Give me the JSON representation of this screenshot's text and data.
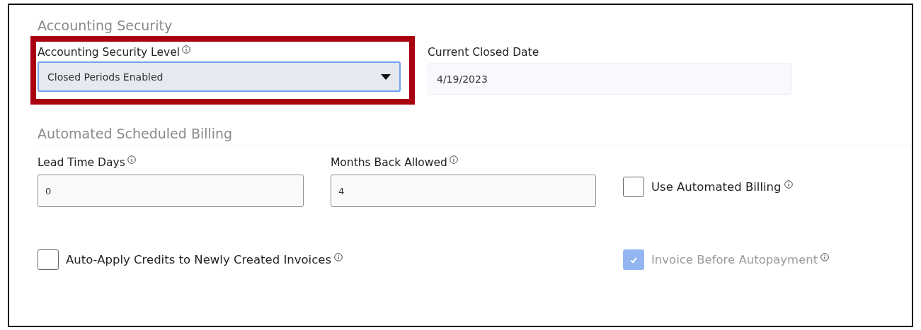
{
  "sections": [
    {
      "title": "Accounting Security",
      "fields": [
        {
          "kind": "select",
          "label": "Accounting Security Level",
          "info": true,
          "value": "Closed Periods Enabled",
          "highlighted": true
        },
        {
          "kind": "readonly",
          "label": "Current Closed Date",
          "value": "4/19/2023"
        }
      ]
    },
    {
      "title": "Automated Scheduled Billing",
      "fields": [
        {
          "kind": "input",
          "label": "Lead Time Days",
          "info": true,
          "value": "0"
        },
        {
          "kind": "input",
          "label": "Months Back Allowed",
          "info": true,
          "value": "4"
        },
        {
          "kind": "checkbox",
          "label": "Use Automated Billing",
          "info": true,
          "checked": false,
          "disabled": false
        },
        {
          "kind": "checkbox",
          "label": "Auto-Apply Credits to Newly Created Invoices",
          "info": true,
          "checked": false,
          "disabled": false
        },
        {
          "kind": "checkbox",
          "label": "Invoice Before Autopayment",
          "info": true,
          "checked": true,
          "disabled": true
        }
      ]
    }
  ]
}
